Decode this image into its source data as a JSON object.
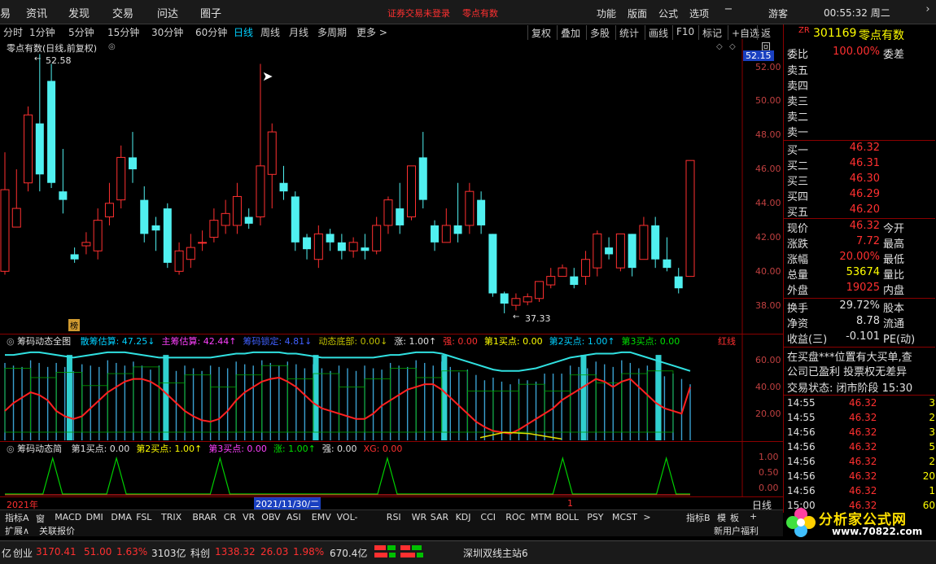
{
  "menu": {
    "items": [
      "资讯",
      "发现",
      "交易",
      "问达",
      "圈子"
    ],
    "left_cut": "易",
    "warning": "证券交易未登录",
    "stock_title": "零点有数",
    "right_items": [
      "功能",
      "版面",
      "公式",
      "选项"
    ],
    "user": "游客",
    "clock": "00:55:32 周二"
  },
  "periods": {
    "items": [
      "分时",
      "1分钟",
      "5分钟",
      "15分钟",
      "30分钟",
      "60分钟",
      "日线",
      "周线",
      "月线",
      "多周期",
      "更多 >"
    ],
    "active_index": 6,
    "tools": [
      "复权",
      "叠加",
      "多股",
      "统计",
      "画线",
      "F10",
      "标记",
      "+自选",
      "返回"
    ]
  },
  "main_chart": {
    "title": "零点有数(日线,前复权)",
    "high_label": "52.58",
    "low_label": "37.33",
    "marker": "榜",
    "current_price_tag": "52.15",
    "price_axis": [
      "52.00",
      "50.00",
      "48.00",
      "46.00",
      "44.00",
      "42.00",
      "40.00",
      "38.00"
    ]
  },
  "ind1": {
    "name": "筹码动态全图",
    "params": [
      {
        "text": "散筹估算: 47.25↓",
        "color": "#00d0ff"
      },
      {
        "text": "主筹估算: 42.44↑",
        "color": "#ff40ff"
      },
      {
        "text": "筹码锁定: 4.81↓",
        "color": "#4060ff"
      },
      {
        "text": "动态底部: 0.00↓",
        "color": "#c0c000"
      },
      {
        "text": "涨: 1.00↑",
        "color": "#e0e0e0"
      },
      {
        "text": "强: 0.00",
        "color": "#ff3030"
      },
      {
        "text": "第1买点: 0.00",
        "color": "#ffff00"
      },
      {
        "text": "第2买点: 1.00↑",
        "color": "#00d0ff"
      },
      {
        "text": "第3买点: 0.00",
        "color": "#00e000"
      }
    ],
    "right_tag": "红线",
    "axis": [
      "60.00",
      "40.00",
      "20.00"
    ]
  },
  "ind2": {
    "name": "筹码动态简",
    "params": [
      {
        "text": "第1买点: 0.00",
        "color": "#e0e0e0"
      },
      {
        "text": "第2买点: 1.00↑",
        "color": "#ffff00"
      },
      {
        "text": "第3买点: 0.00",
        "color": "#ff40ff"
      },
      {
        "text": "涨: 1.00↑",
        "color": "#00e000"
      },
      {
        "text": "强: 0.00",
        "color": "#e0e0e0"
      },
      {
        "text": "XG: 0.00",
        "color": "#ff3030"
      }
    ],
    "axis": [
      "1.00",
      "0.50",
      "0.00"
    ]
  },
  "datebar": {
    "year": "2021年",
    "cursor_date": "2021/11/30/二",
    "tick": "1",
    "period": "日线"
  },
  "tabs": {
    "first": "指标A",
    "items": [
      "窗口",
      "MACD",
      "DMI",
      "DMA",
      "FSL",
      "TRIX",
      "BRAR",
      "CR",
      "VR",
      "OBV",
      "ASI",
      "EMV",
      "VOL-TDX",
      "RSI",
      "WR",
      "SAR",
      "KDJ",
      "CCI",
      "ROC",
      "MTM",
      "BOLL",
      "PSY",
      "MCST",
      ">"
    ],
    "right": [
      "指标B",
      "模",
      "板",
      "+"
    ],
    "row2_left": [
      "扩展∧",
      "关联报价"
    ],
    "row2_right": "新用户福利"
  },
  "status": {
    "left_cut": "亿",
    "cy_label": "创业",
    "cy_value": "3170.41",
    "cy_change": "51.00",
    "cy_pct": "1.63%",
    "cy_amount": "3103亿",
    "kc_label": "科创",
    "kc_value": "1338.32",
    "kc_change": "26.03",
    "kc_pct": "1.98%",
    "kc_amount": "670.4亿",
    "server": "深圳双线主站6"
  },
  "quote": {
    "zr": "ZR",
    "code": "301169",
    "name": "零点有数",
    "webi_label": "委比",
    "webi_value": "100.00%",
    "weicha_label": "委差",
    "sells": [
      "卖五",
      "卖四",
      "卖三",
      "卖二",
      "卖一"
    ],
    "buys": [
      {
        "label": "买一",
        "price": "46.32"
      },
      {
        "label": "买二",
        "price": "46.31"
      },
      {
        "label": "买三",
        "price": "46.30"
      },
      {
        "label": "买四",
        "price": "46.29"
      },
      {
        "label": "买五",
        "price": "46.20"
      }
    ],
    "stats": [
      {
        "l1": "现价",
        "v1": "46.32",
        "c1": "#ff3030",
        "l2": "今开"
      },
      {
        "l1": "涨跌",
        "v1": "7.72",
        "c1": "#ff3030",
        "l2": "最高"
      },
      {
        "l1": "涨幅",
        "v1": "20.00%",
        "c1": "#ff3030",
        "l2": "最低"
      },
      {
        "l1": "总量",
        "v1": "53674",
        "c1": "#ffff00",
        "l2": "量比"
      },
      {
        "l1": "外盘",
        "v1": "19025",
        "c1": "#ff3030",
        "l2": "内盘"
      }
    ],
    "stats2": [
      {
        "l1": "换手",
        "v1": "29.72%",
        "c1": "#e0e0e0",
        "l2": "股本"
      },
      {
        "l1": "净资",
        "v1": "8.78",
        "c1": "#e0e0e0",
        "l2": "流通"
      },
      {
        "l1": "收益(三)",
        "v1": "-0.101",
        "c1": "#e0e0e0",
        "l2": "PE(动)"
      }
    ],
    "news1": "在买盘***位置有大买单,查",
    "news2": "公司已盈利 投票权无差异",
    "trade_status": "交易状态: 闭市阶段 15:30",
    "ticks": [
      {
        "time": "14:55",
        "price": "46.32",
        "vol": "3"
      },
      {
        "time": "14:55",
        "price": "46.32",
        "vol": "2"
      },
      {
        "time": "14:56",
        "price": "46.32",
        "vol": "3"
      },
      {
        "time": "14:56",
        "price": "46.32",
        "vol": "5"
      },
      {
        "time": "14:56",
        "price": "46.32",
        "vol": "2"
      },
      {
        "time": "14:56",
        "price": "46.32",
        "vol": "20"
      },
      {
        "time": "14:56",
        "price": "46.32",
        "vol": "1"
      },
      {
        "time": "15:00",
        "price": "46.32",
        "vol": "60"
      }
    ]
  },
  "logo": {
    "text": "分析家公式网",
    "url": "www.70822.com"
  },
  "colors": {
    "up": "#ff3030",
    "down": "#50f0f0",
    "axis": "#8b0000"
  },
  "chart_data": {
    "type": "candlestick",
    "ylim": [
      36.8,
      52.6
    ],
    "candles": [
      [
        39.8,
        44.6,
        39.6,
        46.8
      ],
      [
        42.4,
        43.5,
        42.4,
        45.8
      ],
      [
        45.0,
        49.0,
        44.5,
        49.5
      ],
      [
        48.5,
        45.5,
        44.5,
        52.58
      ],
      [
        51.0,
        45.0,
        44.7,
        52.0
      ],
      [
        44.5,
        44.0,
        43.2,
        47.0
      ],
      [
        40.8,
        40.5,
        40.3,
        41.2
      ],
      [
        41.3,
        41.5,
        40.8,
        42.1
      ],
      [
        41.0,
        42.8,
        40.5,
        43.5
      ],
      [
        43.0,
        43.8,
        42.5,
        45.0
      ],
      [
        44.0,
        46.5,
        43.5,
        47.2
      ],
      [
        46.5,
        45.8,
        45.0,
        48.0
      ],
      [
        44.0,
        42.0,
        41.5,
        44.8
      ],
      [
        42.5,
        42.2,
        41.0,
        43.0
      ],
      [
        43.5,
        40.3,
        40.0,
        43.8
      ],
      [
        39.8,
        41.0,
        39.6,
        41.5
      ],
      [
        40.5,
        41.2,
        40.0,
        42.0
      ],
      [
        41.5,
        41.5,
        41.0,
        42.2
      ],
      [
        41.8,
        42.8,
        41.5,
        43.5
      ],
      [
        42.5,
        43.2,
        42.0,
        44.0
      ],
      [
        42.5,
        44.2,
        42.0,
        45.0
      ],
      [
        43.0,
        42.6,
        42.3,
        43.5
      ],
      [
        43.0,
        46.0,
        42.5,
        52.0
      ],
      [
        45.5,
        48.0,
        43.5,
        48.5
      ],
      [
        45.0,
        44.5,
        44.0,
        46.0
      ],
      [
        44.2,
        41.5,
        41.0,
        44.5
      ],
      [
        41.8,
        41.1,
        40.5,
        42.0
      ],
      [
        40.5,
        42.0,
        40.0,
        42.5
      ],
      [
        42.0,
        41.5,
        41.0,
        42.3
      ],
      [
        41.5,
        41.0,
        40.5,
        42.0
      ],
      [
        41.0,
        41.5,
        40.6,
        41.8
      ],
      [
        41.2,
        41.0,
        40.5,
        42.0
      ],
      [
        41.0,
        42.5,
        40.8,
        43.0
      ],
      [
        42.5,
        44.0,
        42.0,
        44.2
      ],
      [
        43.5,
        42.5,
        42.0,
        45.0
      ],
      [
        43.0,
        46.0,
        42.8,
        46.0
      ],
      [
        46.5,
        44.0,
        43.5,
        48.0
      ],
      [
        42.5,
        41.5,
        41.0,
        42.8
      ],
      [
        41.5,
        42.5,
        41.5,
        43.5
      ],
      [
        42.5,
        42.0,
        41.5,
        45.0
      ],
      [
        42.5,
        44.5,
        42.0,
        45.0
      ],
      [
        44.0,
        42.5,
        42.0,
        44.5
      ],
      [
        42.0,
        38.5,
        38.3,
        42.0
      ],
      [
        38.5,
        37.9,
        37.33,
        38.6
      ],
      [
        37.8,
        38.2,
        37.5,
        38.5
      ],
      [
        38.0,
        38.3,
        37.8,
        38.5
      ],
      [
        38.2,
        39.2,
        38.0,
        39.2
      ],
      [
        39.0,
        39.5,
        38.8,
        40.0
      ],
      [
        39.5,
        40.0,
        39.5,
        40.2
      ],
      [
        39.5,
        39.0,
        38.8,
        40.0
      ],
      [
        39.5,
        40.5,
        39.0,
        41.0
      ],
      [
        40.0,
        42.0,
        39.5,
        42.2
      ],
      [
        41.2,
        40.8,
        40.5,
        41.8
      ],
      [
        40.0,
        42.0,
        39.8,
        42.0
      ],
      [
        42.0,
        40.0,
        39.5,
        42.0
      ],
      [
        40.5,
        42.5,
        40.5,
        43.0
      ],
      [
        42.5,
        40.5,
        40.0,
        43.0
      ],
      [
        40.5,
        40.0,
        39.8,
        41.8
      ],
      [
        39.5,
        38.8,
        38.5,
        40.0
      ],
      [
        39.5,
        46.32,
        39.5,
        46.32
      ]
    ],
    "ind1_red_line": [
      22,
      28,
      32,
      36,
      34,
      30,
      22,
      18,
      16,
      18,
      24,
      30,
      36,
      40,
      44,
      46,
      46,
      44,
      40,
      34,
      28,
      22,
      18,
      15,
      14,
      16,
      22,
      30,
      36,
      40,
      44,
      46,
      47,
      44,
      40,
      34,
      28,
      24,
      22,
      20,
      18,
      16,
      16,
      20,
      26,
      30,
      34,
      38,
      40,
      42,
      42,
      38,
      32,
      26,
      20,
      14,
      10,
      7,
      6,
      5,
      8,
      12,
      16,
      20,
      24,
      30,
      34,
      38,
      42,
      46,
      44,
      40,
      44,
      46,
      40,
      34,
      28,
      24,
      22,
      20,
      40
    ],
    "ind1_green_top": [
      64,
      64,
      65,
      66,
      66,
      65,
      64,
      63,
      62,
      63,
      64,
      65,
      66,
      66,
      66,
      65,
      64,
      63,
      62,
      62,
      62,
      62,
      62,
      62,
      62,
      63,
      64,
      65,
      65,
      66,
      66,
      66,
      66,
      65,
      65,
      64,
      63,
      62,
      62,
      62,
      62,
      62,
      62,
      62,
      63,
      64,
      64,
      65,
      66,
      66,
      66,
      65,
      63,
      61,
      59,
      57,
      55,
      53,
      52,
      52,
      52,
      53,
      54,
      56,
      58,
      60,
      62,
      63,
      64,
      65,
      65,
      65,
      66,
      66,
      64,
      62,
      60,
      58,
      56,
      54,
      52
    ],
    "ind1_thick_bars": [
      6,
      15,
      29,
      41,
      54,
      61
    ],
    "ind2_peaks": [
      6,
      14,
      27,
      48,
      70,
      83
    ]
  }
}
